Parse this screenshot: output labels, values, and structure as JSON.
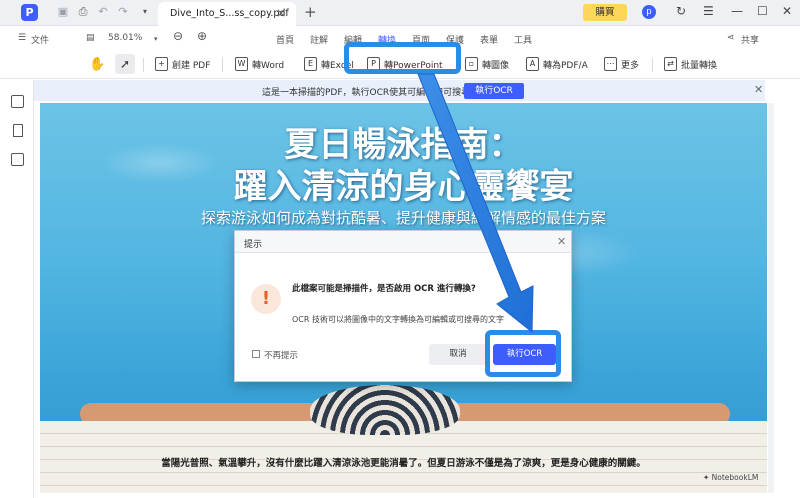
{
  "titlebar": {
    "app_logo": "P",
    "tab_title": "Dive_Into_S...ss_copy.pdf",
    "buy_label": "購買",
    "avatar_letter": "p"
  },
  "menu": {
    "file_label": "文件",
    "zoom": "58.01%",
    "items": [
      "首頁",
      "註解",
      "編輯",
      "轉換",
      "頁面",
      "保護",
      "表單",
      "工具"
    ],
    "share_label": "共享"
  },
  "toolbar": {
    "tools": [
      "創建 PDF",
      "轉Word",
      "轉Excel",
      "轉PowerPoint",
      "轉圖像",
      "轉為PDF/A",
      "更多",
      "批量轉換"
    ]
  },
  "banner": {
    "text": "這是一本掃描的PDF，執行OCR使其可編輯和可搜尋。",
    "button_label": "執行OCR"
  },
  "document": {
    "title_line1": "夏日暢泳指南：",
    "title_line2": "躍入清涼的身心靈饗宴",
    "subtitle": "探索游泳如何成為對抗酷暑、提升健康與紓解情感的最佳方案",
    "caption": "當陽光普照、氣溫攀升，沒有什麼比躍入清涼泳池更能消暑了。但夏日游泳不僅是為了涼爽，更是身心健康的關鍵。",
    "watermark": "NotebookLM"
  },
  "dialog": {
    "title": "提示",
    "main_message": "此檔案可能是掃描件，是否啟用 OCR 進行轉換?",
    "description": "OCR 技術可以將圖像中的文字轉換為可編輯或可搜尋的文字",
    "checkbox_label": "不再提示",
    "cancel_label": "取消",
    "ocr_label": "執行OCR"
  },
  "colors": {
    "accent": "#3d5dff",
    "annotation": "#2b8be6",
    "buy": "#ffd55a"
  }
}
